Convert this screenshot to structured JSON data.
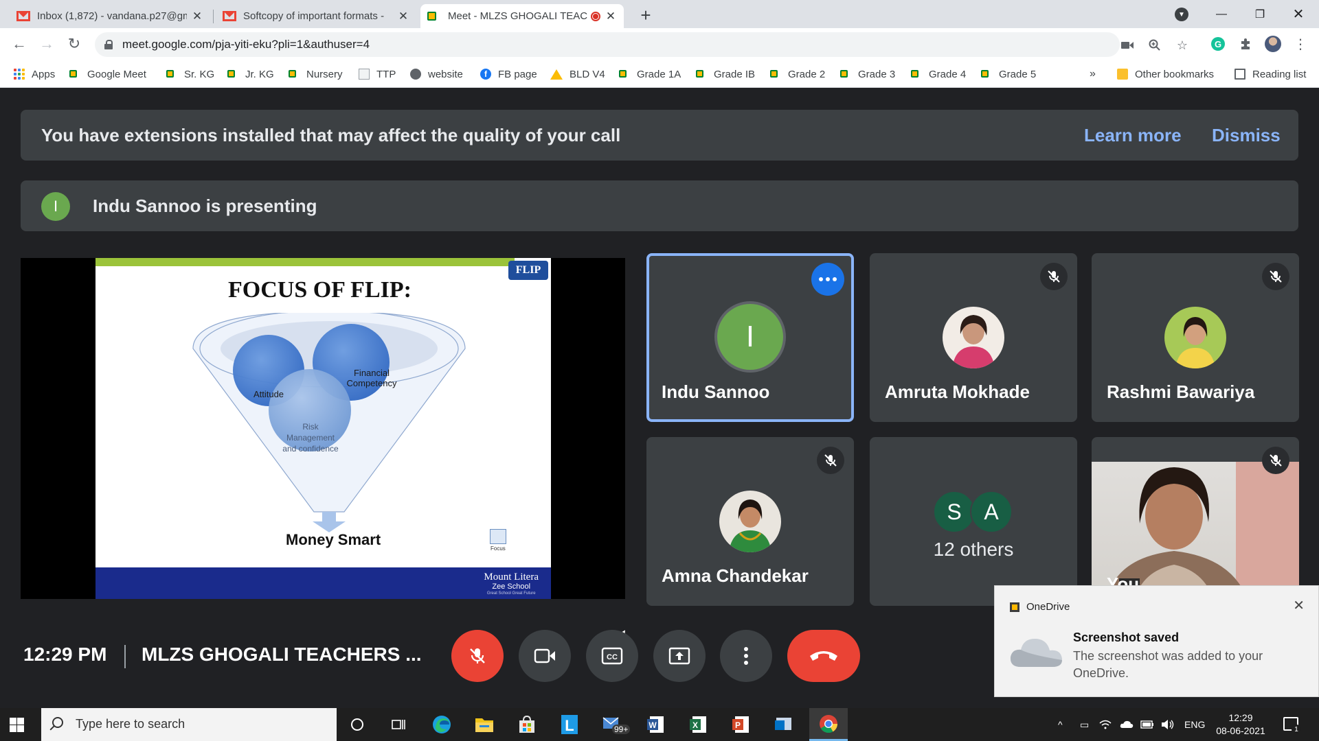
{
  "browser": {
    "tabs": [
      {
        "title": "Inbox (1,872) - vandana.p27@gm",
        "icon": "gmail-icon"
      },
      {
        "title": "Softcopy of important formats - ",
        "icon": "gmail-icon"
      },
      {
        "title": "Meet - MLZS GHOGALI TEAC",
        "icon": "meet-icon"
      }
    ],
    "url": "meet.google.com/pja-yiti-eku?pli=1&authuser=4",
    "bookmarks": [
      {
        "label": "Apps",
        "icon": "apps-icon"
      },
      {
        "label": "Google Meet",
        "icon": "meet-icon"
      },
      {
        "label": "Sr. KG",
        "icon": "meet-icon"
      },
      {
        "label": "Jr. KG",
        "icon": "meet-icon"
      },
      {
        "label": "Nursery",
        "icon": "meet-icon"
      },
      {
        "label": "TTP",
        "icon": "page-icon"
      },
      {
        "label": "website",
        "icon": "globe-icon"
      },
      {
        "label": "FB page",
        "icon": "facebook-icon"
      },
      {
        "label": "BLD V4",
        "icon": "drive-icon"
      },
      {
        "label": "Grade 1A",
        "icon": "meet-icon"
      },
      {
        "label": "Grade IB",
        "icon": "meet-icon"
      },
      {
        "label": "Grade 2",
        "icon": "meet-icon"
      },
      {
        "label": "Grade 3",
        "icon": "meet-icon"
      },
      {
        "label": "Grade 4",
        "icon": "meet-icon"
      },
      {
        "label": "Grade 5",
        "icon": "meet-icon"
      }
    ],
    "overflow": "»",
    "other_bookmarks": "Other bookmarks",
    "reading_list": "Reading list"
  },
  "meet": {
    "banner": {
      "text": "You have extensions installed that may affect the quality of your call",
      "learn_more": "Learn more",
      "dismiss": "Dismiss"
    },
    "presenting": {
      "initial": "I",
      "text": "Indu Sannoo is presenting"
    },
    "slide": {
      "logo": "FLIP",
      "title": "FOCUS OF FLIP:",
      "circles": [
        "Financial Competency",
        "Attitude",
        "Risk Management and confidence"
      ],
      "bottom": "Money Smart",
      "focus_label": "Focus",
      "footer_brand": "Mount Litera",
      "footer_sub": "Zee School",
      "footer_tag": "Great School Great Future"
    },
    "participants": [
      {
        "name": "Indu Sannoo",
        "initial": "I",
        "active": true
      },
      {
        "name": "Amruta Mokhade",
        "muted": true
      },
      {
        "name": "Rashmi Bawariya",
        "muted": true
      },
      {
        "name": "Amna Chandekar",
        "muted": true
      },
      {
        "initials": [
          "S",
          "A"
        ],
        "label": "12 others"
      },
      {
        "name": "You",
        "muted": true
      }
    ],
    "time": "12:29 PM",
    "meeting_title": "MLZS GHOGALI TEACHERS ...",
    "colors": {
      "accent": "#8ab4f8",
      "danger": "#ea4335",
      "tile": "#3c4043"
    }
  },
  "toast": {
    "app": "OneDrive",
    "title": "Screenshot saved",
    "body": "The screenshot was added to your OneDrive."
  },
  "taskbar": {
    "search_placeholder": "Type here to search",
    "mail_badge": "99+",
    "language": "ENG",
    "time": "12:29",
    "date": "08-06-2021",
    "notifications": "1"
  }
}
